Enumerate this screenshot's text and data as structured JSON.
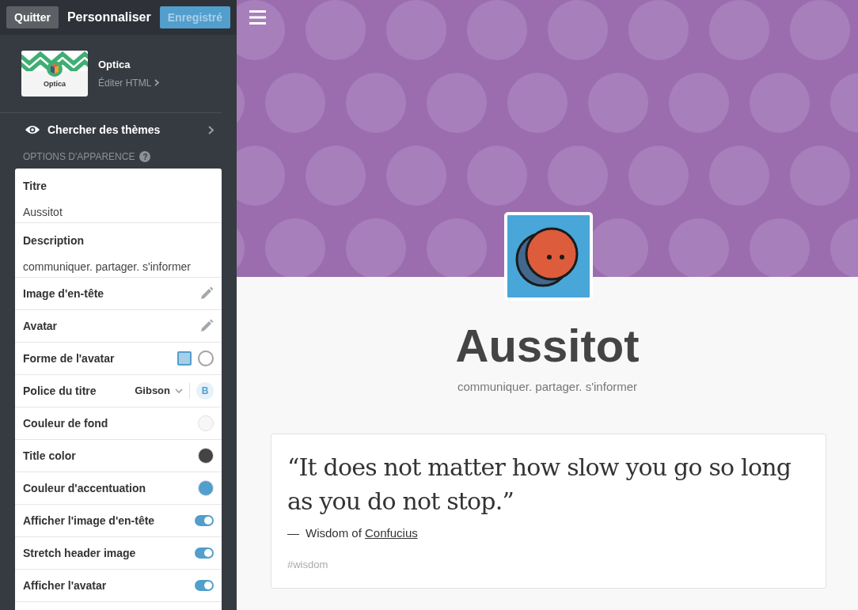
{
  "sidebar": {
    "quit_button": "Quitter",
    "title": "Personnaliser",
    "save_button": "Enregistré",
    "theme": {
      "thumbnail_label": "Optica",
      "name": "Optica",
      "edit_link": "Éditer HTML"
    },
    "browse_themes": "Chercher des thèmes",
    "section_heading": "OPTIONS D'APPARENCE",
    "help_icon": "?",
    "options": [
      {
        "kind": "text",
        "label": "Titre",
        "value": "Aussitot"
      },
      {
        "kind": "text",
        "label": "Description",
        "value": "communiquer. partager. s'informer"
      },
      {
        "kind": "edit",
        "label": "Image d'en-tête"
      },
      {
        "kind": "edit",
        "label": "Avatar"
      },
      {
        "kind": "shape",
        "label": "Forme de l'avatar",
        "shapes": [
          {
            "kind": "square",
            "selected": true
          },
          {
            "kind": "circle",
            "selected": false
          }
        ]
      },
      {
        "kind": "font",
        "label": "Police du titre",
        "value": "Gibson",
        "bold_label": "B",
        "bold": true
      },
      {
        "kind": "color",
        "label": "Couleur de fond",
        "color": "#f7f7f7"
      },
      {
        "kind": "color",
        "label": "Title color",
        "color": "#444444"
      },
      {
        "kind": "color",
        "label": "Couleur d'accentuation",
        "color": "#529ecc"
      },
      {
        "kind": "toggle",
        "label": "Afficher l'image d'en-tête",
        "on": true
      },
      {
        "kind": "toggle",
        "label": "Stretch header image",
        "on": true
      },
      {
        "kind": "toggle",
        "label": "Afficher l'avatar",
        "on": true
      }
    ]
  },
  "preview": {
    "title": "Aussitot",
    "description": "communiquer. partager. s'informer",
    "post": {
      "quote": "“It does not matter how slow you go so long as you do not stop.”",
      "dash": "—",
      "attribution": "Wisdom of ",
      "source": "Confucius",
      "tag": "#wisdom"
    }
  }
}
